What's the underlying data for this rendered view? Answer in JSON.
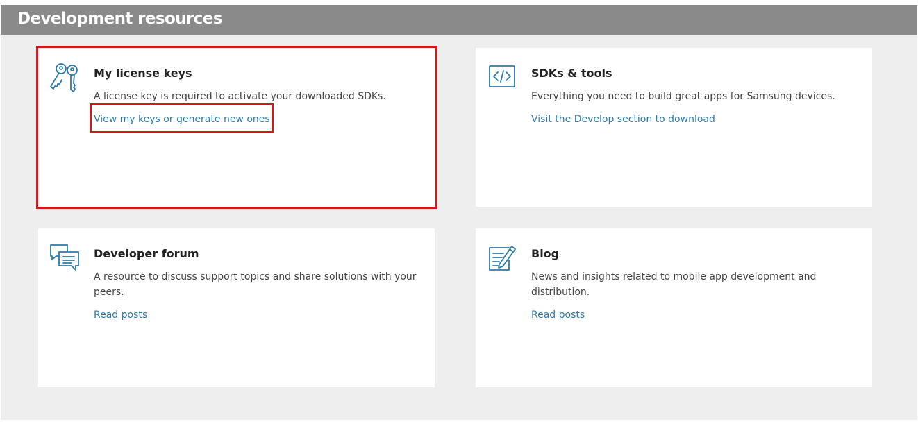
{
  "header": {
    "title": "Development resources"
  },
  "cards": [
    {
      "title": "My license keys",
      "description": "A license key is required to activate your downloaded SDKs.",
      "link": "View my keys or generate new ones",
      "icon": "keys-icon"
    },
    {
      "title": "SDKs & tools",
      "description": "Everything you need to build great apps for Samsung devices.",
      "link": "Visit the Develop section to download",
      "icon": "code-icon"
    },
    {
      "title": "Developer forum",
      "description": "A resource to discuss support topics and share solutions with your peers.",
      "link": "Read posts",
      "icon": "chat-bubbles-icon"
    },
    {
      "title": "Blog",
      "description": "News and insights related to mobile app development and distribution.",
      "link": "Read posts",
      "icon": "edit-note-icon"
    }
  ],
  "colors": {
    "header_bg": "#8a8a8a",
    "page_bg": "#eeeeee",
    "icon": "#2f7ba8",
    "link": "#2f7ba8",
    "highlight": "#d11919"
  }
}
